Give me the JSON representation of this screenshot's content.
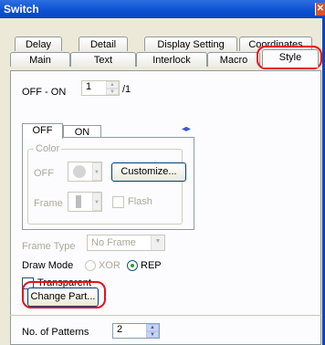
{
  "window": {
    "title": "Switch",
    "close_glyph": "✕"
  },
  "tabs": {
    "row_back": [
      "Delay",
      "Detail",
      "Display Setting",
      "Coordinates"
    ],
    "row_front": [
      "Main",
      "Text",
      "Interlock",
      "Macro",
      "Style"
    ],
    "selected": "Style"
  },
  "off_on": {
    "label": "OFF - ON",
    "value": "1",
    "total": "/1"
  },
  "inner_tabs": {
    "off": "OFF",
    "on": "ON",
    "nav": "◂▸"
  },
  "color_group": {
    "legend": "Color",
    "off_label": "OFF",
    "frame_label": "Frame",
    "customize_label": "Customize...",
    "flash_label": "Flash"
  },
  "frame_type": {
    "label": "Frame Type",
    "value": "No Frame"
  },
  "draw_mode": {
    "label": "Draw Mode",
    "xor_label": "XOR",
    "rep_label": "REP",
    "selected": "REP"
  },
  "transparent": {
    "label": "Transparent",
    "checked": false
  },
  "change_part": {
    "label": "Change Part..."
  },
  "patterns": {
    "label": "No. of Patterns",
    "value": "2"
  },
  "highlight_color": "#e8101a"
}
